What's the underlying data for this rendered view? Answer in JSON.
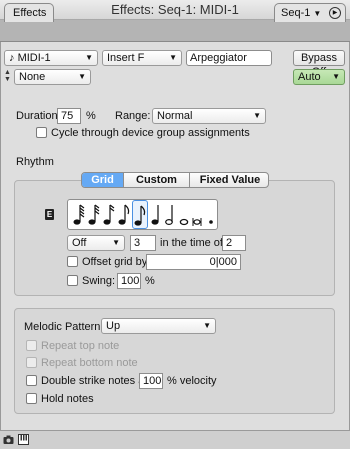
{
  "window": {
    "title": "Effects: Seq-1: MIDI-1"
  },
  "tabs": {
    "effects": "Effects",
    "seq": "Seq-1"
  },
  "top": {
    "device_select": "MIDI-1",
    "insert_select": "Insert F",
    "effect_name": "Arpeggiator",
    "bypass_button": "Bypass Off",
    "preset_select": "None",
    "auto_select": "Auto"
  },
  "settings": {
    "duration_label": "Duration",
    "duration_value": "75",
    "duration_unit": "%",
    "range_label": "Range:",
    "range_value": "Normal",
    "cycle_label": "Cycle through device group assignments"
  },
  "rhythm": {
    "heading": "Rhythm",
    "tabs": [
      "Grid",
      "Custom",
      "Fixed Value"
    ],
    "grid": {
      "mode_select": "Off",
      "count_value": "3",
      "in_the_time_of_label": "in the time of",
      "time_value": "2",
      "offset_label": "Offset grid by",
      "offset_value": "0|000",
      "swing_label": "Swing:",
      "swing_value": "100",
      "swing_unit": "%"
    }
  },
  "melodic": {
    "pattern_label": "Melodic Pattern:",
    "pattern_value": "Up",
    "repeat_top_label": "Repeat top note",
    "repeat_bottom_label": "Repeat bottom note",
    "double_strike_label": "Double strike notes at",
    "double_strike_value": "100",
    "double_strike_unit": "% velocity",
    "hold_label": "Hold notes"
  },
  "colors": {
    "accent": "#65a9f4",
    "auto_green": "#a9d896",
    "close_red": "#fc605c"
  }
}
